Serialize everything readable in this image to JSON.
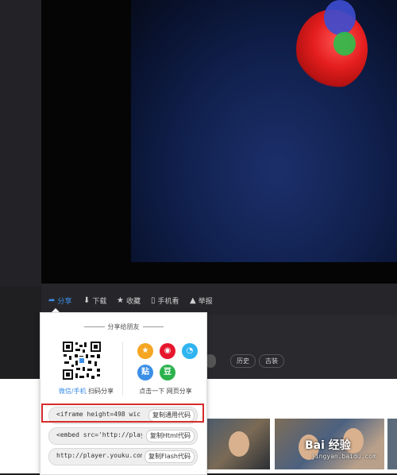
{
  "toolbar": {
    "share": "分享",
    "download": "下载",
    "favorite": "收藏",
    "mobile": "手机看",
    "report": "举报"
  },
  "chips": {
    "history": "历史",
    "costume": "古装"
  },
  "share_popup": {
    "title": "分享给朋友",
    "qr_caption_highlight": "微信/手机",
    "qr_caption_rest": " 扫码分享",
    "web_caption": "点击一下 网页分享",
    "icons": [
      {
        "name": "qzone-icon",
        "glyph": "★",
        "color": "#f5a623"
      },
      {
        "name": "weibo-icon",
        "glyph": "◉",
        "color": "#e6162d"
      },
      {
        "name": "qq-icon",
        "glyph": "◔",
        "color": "#2fb4f0"
      },
      {
        "name": "tieba-icon",
        "glyph": "贴",
        "color": "#3a8ee6"
      },
      {
        "name": "douban-icon",
        "glyph": "豆",
        "color": "#2bb24c"
      }
    ],
    "codes": [
      {
        "code": "<iframe height=498 wic",
        "button": "复制通用代码"
      },
      {
        "code": "<embed src='http://play",
        "button": "复制Html代码"
      },
      {
        "code": "http://player.youku.com",
        "button": "复制Flash代码"
      }
    ]
  },
  "watermark": {
    "main": "Bai 经验",
    "sub": "jingyan.baidu.com"
  }
}
